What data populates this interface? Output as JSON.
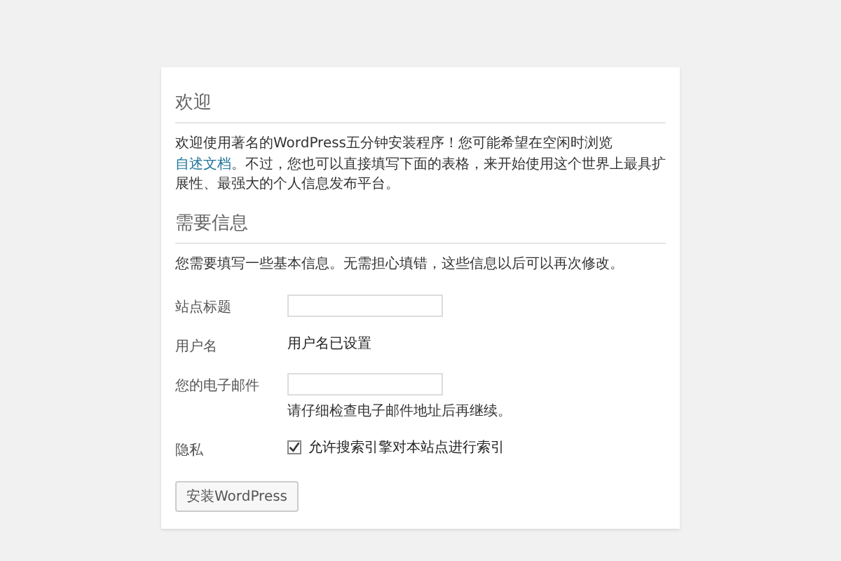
{
  "welcome": {
    "heading": "欢迎",
    "text_before": "欢迎使用著名的WordPress五分钟安装程序！您可能希望在空闲时浏览",
    "link": "自述文档",
    "text_after": "。不过，您也可以直接填写下面的表格，来开始使用这个世界上最具扩展性、最强大的个人信息发布平台。"
  },
  "info": {
    "heading": "需要信息",
    "intro": "您需要填写一些基本信息。无需担心填错，这些信息以后可以再次修改。",
    "fields": [
      {
        "kind": "input",
        "label": "站点标题"
      },
      {
        "kind": "text",
        "label": "用户名",
        "value": "用户名已设置"
      },
      {
        "kind": "input",
        "label": "您的电子邮件",
        "hint": "请仔细检查电子邮件地址后再继续。"
      },
      {
        "kind": "checkbox",
        "label": "隐私",
        "text": "允许搜索引擎对本站点进行索引",
        "checked": true
      }
    ]
  },
  "button": "安装WordPress"
}
